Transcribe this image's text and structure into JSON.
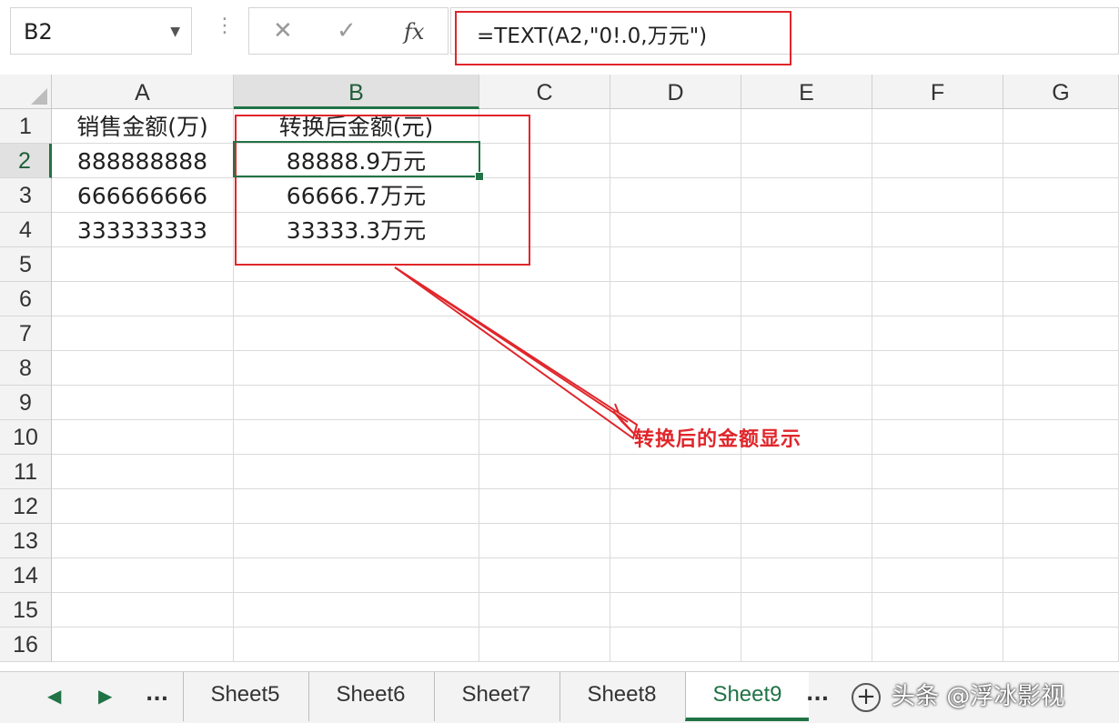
{
  "namebox": {
    "value": "B2"
  },
  "formula": {
    "text": "=TEXT(A2,\"0!.0,万元\")",
    "fx_label": "fx",
    "cancel_symbol": "✕",
    "enter_symbol": "✓"
  },
  "columns": [
    "A",
    "B",
    "C",
    "D",
    "E",
    "F",
    "G"
  ],
  "rows": [
    "1",
    "2",
    "3",
    "4",
    "5",
    "6",
    "7",
    "8",
    "9",
    "10",
    "11",
    "12",
    "13",
    "14",
    "15",
    "16"
  ],
  "cells": {
    "A1": "销售金额(万)",
    "B1": "转换后金额(元)",
    "A2": "888888888",
    "B2": "88888.9万元",
    "A3": "666666666",
    "B3": "66666.7万元",
    "A4": "333333333",
    "B4": "33333.3万元"
  },
  "selected_cell": "B2",
  "annotation": {
    "text": "转换后的金额显示",
    "color": "#e0262b"
  },
  "highlight_color": "#e0262b",
  "accent_color": "#217346",
  "tabs": [
    "Sheet5",
    "Sheet6",
    "Sheet7",
    "Sheet8",
    "Sheet9"
  ],
  "active_tab": "Sheet9",
  "tab_nav": {
    "prev": "◀",
    "next": "▶",
    "more": "...",
    "more_right": "...",
    "add": "+"
  },
  "watermark": "头条 @浮冰影视"
}
